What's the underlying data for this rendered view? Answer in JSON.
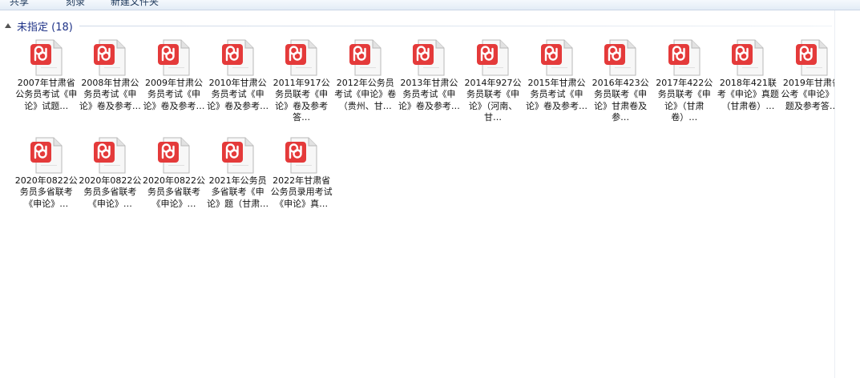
{
  "toolbar": {
    "buttons": [
      "共享",
      "刻录",
      "新建文件夹"
    ]
  },
  "group": {
    "title": "未指定 (18)"
  },
  "files": [
    {
      "name": "2007年甘肃省公务员考试《申论》试题…"
    },
    {
      "name": "2008年甘肃公务员考试《申论》卷及参考…"
    },
    {
      "name": "2009年甘肃公务员考试《申论》卷及参考…"
    },
    {
      "name": "2010年甘肃公务员考试《申论》卷及参考…"
    },
    {
      "name": "2011年917公务员联考《申论》卷及参考答…"
    },
    {
      "name": "2012年公务员考试《申论》卷（贵州、甘…"
    },
    {
      "name": "2013年甘肃公务员考试《申论》卷及参考…"
    },
    {
      "name": "2014年927公务员联考《申论》（河南、甘…"
    },
    {
      "name": "2015年甘肃公务员考试《申论》卷及参考…"
    },
    {
      "name": "2016年423公务员联考《申论》甘肃卷及参…"
    },
    {
      "name": "2017年422公务员联考《申论》（甘肃卷）…"
    },
    {
      "name": "2018年421联考《申论》真题（甘肃卷）…"
    },
    {
      "name": "2019年甘肃省公考《申论》真题及参考答…"
    },
    {
      "name": "2020年0822公务员多省联考《申论》…"
    },
    {
      "name": "2020年0822公务员多省联考《申论》…"
    },
    {
      "name": "2020年0822公务员多省联考《申论》…"
    },
    {
      "name": "2021年公务员多省联考《申论》题（甘肃…"
    },
    {
      "name": "2022年甘肃省公务员录用考试《申论》真…"
    }
  ],
  "icon": {
    "name": "pdf-file-icon",
    "badge_color": "#e43a3a",
    "page_color": "#f7f7f7"
  }
}
